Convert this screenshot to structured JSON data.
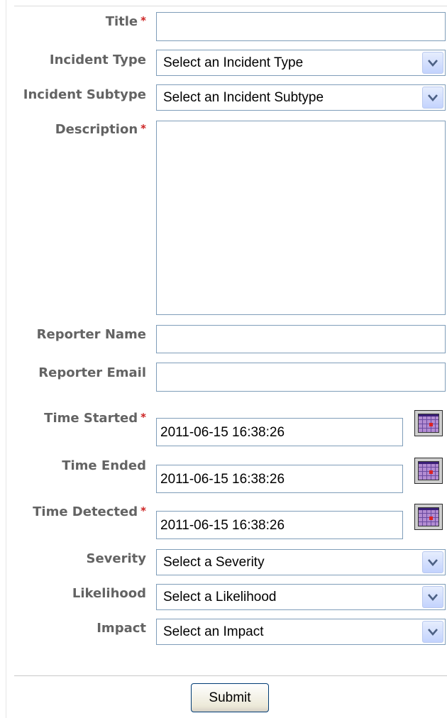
{
  "form": {
    "title": {
      "label": "Title",
      "required_mark": "*",
      "value": ""
    },
    "incident_type": {
      "label": "Incident Type",
      "selected": "Select an Incident Type"
    },
    "incident_subtype": {
      "label": "Incident Subtype",
      "selected": "Select an Incident Subtype"
    },
    "description": {
      "label": "Description",
      "required_mark": "*",
      "value": ""
    },
    "reporter_name": {
      "label": "Reporter Name",
      "value": ""
    },
    "reporter_email": {
      "label": "Reporter Email",
      "value": ""
    },
    "time_started": {
      "label": "Time Started",
      "required_mark": "*",
      "value": "2011-06-15 16:38:26"
    },
    "time_ended": {
      "label": "Time Ended",
      "value": "2011-06-15 16:38:26"
    },
    "time_detected": {
      "label": "Time Detected",
      "required_mark": "*",
      "value": "2011-06-15 16:38:26"
    },
    "severity": {
      "label": "Severity",
      "selected": "Select a Severity"
    },
    "likelihood": {
      "label": "Likelihood",
      "selected": "Select a Likelihood"
    },
    "impact": {
      "label": "Impact",
      "selected": "Select an Impact"
    },
    "submit_label": "Submit"
  },
  "icons": {
    "dropdown": "chevron-down-icon",
    "calendar": "calendar-icon"
  },
  "colors": {
    "required": "#cc2222",
    "label": "#636363",
    "input_border": "#7f9db9"
  }
}
